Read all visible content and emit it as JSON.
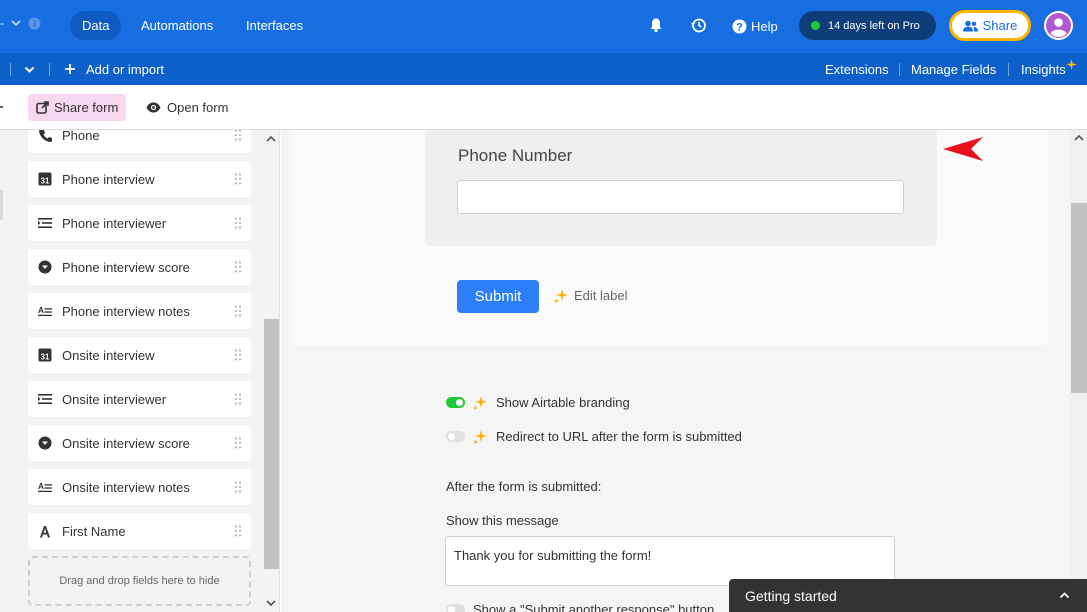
{
  "topbar": {
    "tabs": [
      {
        "label": "Data",
        "active": true
      },
      {
        "label": "Automations",
        "active": false
      },
      {
        "label": "Interfaces",
        "active": false
      }
    ],
    "help_label": "Help",
    "trial_label": "14 days left on Pro",
    "share_label": "Share",
    "colors": {
      "bar": "#166ee1",
      "accent": "#fcb400",
      "trial_dot": "#20c933"
    }
  },
  "toolbar2": {
    "add_import_label": "Add or import",
    "extensions_label": "Extensions",
    "manage_fields_label": "Manage Fields",
    "insights_label": "Insights"
  },
  "viewbar": {
    "share_form_label": "Share form",
    "open_form_label": "Open form"
  },
  "sidebar": {
    "fields": [
      {
        "label": "Phone",
        "icon": "phone-icon"
      },
      {
        "label": "Phone interview",
        "icon": "calendar-icon"
      },
      {
        "label": "Phone interviewer",
        "icon": "collaborator-icon"
      },
      {
        "label": "Phone interview score",
        "icon": "single-select-icon"
      },
      {
        "label": "Phone interview notes",
        "icon": "long-text-icon"
      },
      {
        "label": "Onsite interview",
        "icon": "calendar-icon"
      },
      {
        "label": "Onsite interviewer",
        "icon": "collaborator-icon"
      },
      {
        "label": "Onsite interview score",
        "icon": "single-select-icon"
      },
      {
        "label": "Onsite interview notes",
        "icon": "long-text-icon"
      },
      {
        "label": "First Name",
        "icon": "text-icon"
      }
    ],
    "dropzone_label": "Drag and drop fields here to hide"
  },
  "form": {
    "field_label": "Phone Number",
    "field_value": "",
    "submit_label": "Submit",
    "edit_label": "Edit label",
    "show_branding_label": "Show Airtable branding",
    "show_branding_on": true,
    "redirect_label": "Redirect to URL after the form is submitted",
    "redirect_on": false,
    "after_submit_label": "After the form is submitted:",
    "show_message_label": "Show this message",
    "message_value": "Thank you for submitting the form!",
    "submit_another_label": "Show a \"Submit another response\" button"
  },
  "getting_started": {
    "label": "Getting started"
  }
}
